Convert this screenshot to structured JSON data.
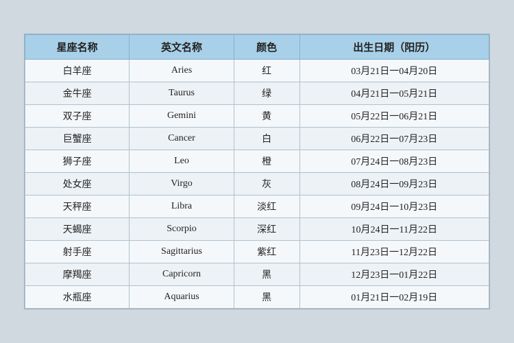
{
  "table": {
    "headers": [
      "星座名称",
      "英文名称",
      "颜色",
      "出生日期（阳历）"
    ],
    "rows": [
      [
        "白羊座",
        "Aries",
        "红",
        "03月21日一04月20日"
      ],
      [
        "金牛座",
        "Taurus",
        "绿",
        "04月21日一05月21日"
      ],
      [
        "双子座",
        "Gemini",
        "黄",
        "05月22日一06月21日"
      ],
      [
        "巨蟹座",
        "Cancer",
        "白",
        "06月22日一07月23日"
      ],
      [
        "狮子座",
        "Leo",
        "橙",
        "07月24日一08月23日"
      ],
      [
        "处女座",
        "Virgo",
        "灰",
        "08月24日一09月23日"
      ],
      [
        "天秤座",
        "Libra",
        "淡红",
        "09月24日一10月23日"
      ],
      [
        "天蝎座",
        "Scorpio",
        "深红",
        "10月24日一11月22日"
      ],
      [
        "射手座",
        "Sagittarius",
        "紫红",
        "11月23日一12月22日"
      ],
      [
        "摩羯座",
        "Capricorn",
        "黑",
        "12月23日一01月22日"
      ],
      [
        "水瓶座",
        "Aquarius",
        "黑",
        "01月21日一02月19日"
      ]
    ]
  }
}
